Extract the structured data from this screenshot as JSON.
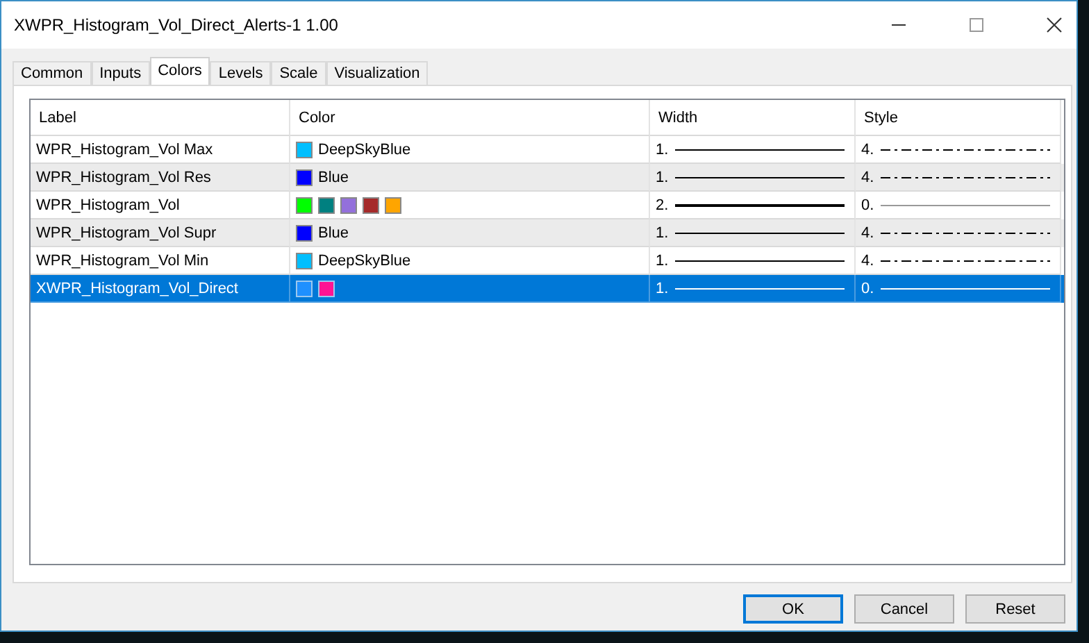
{
  "window": {
    "title": "XWPR_Histogram_Vol_Direct_Alerts-1 1.00"
  },
  "tabs": [
    {
      "label": "Common",
      "selected": false
    },
    {
      "label": "Inputs",
      "selected": false
    },
    {
      "label": "Colors",
      "selected": true
    },
    {
      "label": "Levels",
      "selected": false
    },
    {
      "label": "Scale",
      "selected": false
    },
    {
      "label": "Visualization",
      "selected": false
    }
  ],
  "table": {
    "columns": [
      "Label",
      "Color",
      "Width",
      "Style"
    ],
    "rows": [
      {
        "label": "WPR_Histogram_Vol Max",
        "swatches": [
          {
            "color": "#00bfff"
          }
        ],
        "color_name": "DeepSkyBlue",
        "width": {
          "text": "1.",
          "kind": "thin"
        },
        "style": {
          "text": "4.",
          "kind": "dashdot"
        },
        "selected": false
      },
      {
        "label": "WPR_Histogram_Vol Res",
        "swatches": [
          {
            "color": "#0000ff"
          }
        ],
        "color_name": "Blue",
        "width": {
          "text": "1.",
          "kind": "thin"
        },
        "style": {
          "text": "4.",
          "kind": "dashdot"
        },
        "selected": false
      },
      {
        "label": "WPR_Histogram_Vol",
        "swatches": [
          {
            "color": "#00ff00"
          },
          {
            "color": "#008080"
          },
          {
            "color": "#9370db"
          },
          {
            "color": "#a52a2a"
          },
          {
            "color": "#ffa500"
          }
        ],
        "width": {
          "text": "2.",
          "kind": "thick"
        },
        "style": {
          "text": "0.",
          "kind": "solid"
        },
        "selected": false
      },
      {
        "label": "WPR_Histogram_Vol Supr",
        "swatches": [
          {
            "color": "#0000ff"
          }
        ],
        "color_name": "Blue",
        "width": {
          "text": "1.",
          "kind": "thin"
        },
        "style": {
          "text": "4.",
          "kind": "dashdot"
        },
        "selected": false
      },
      {
        "label": "WPR_Histogram_Vol Min",
        "swatches": [
          {
            "color": "#00bfff"
          }
        ],
        "color_name": "DeepSkyBlue",
        "width": {
          "text": "1.",
          "kind": "thin"
        },
        "style": {
          "text": "4.",
          "kind": "dashdot"
        },
        "selected": false
      },
      {
        "label": "XWPR_Histogram_Vol_Direct",
        "swatches": [
          {
            "color": "#1e90ff"
          },
          {
            "color": "#ff1493"
          }
        ],
        "width": {
          "text": "1.",
          "kind": "thin"
        },
        "style": {
          "text": "0.",
          "kind": "solid"
        },
        "selected": true
      }
    ]
  },
  "buttons": [
    {
      "label": "OK",
      "default": true
    },
    {
      "label": "Cancel",
      "default": false
    },
    {
      "label": "Reset",
      "default": false
    }
  ]
}
